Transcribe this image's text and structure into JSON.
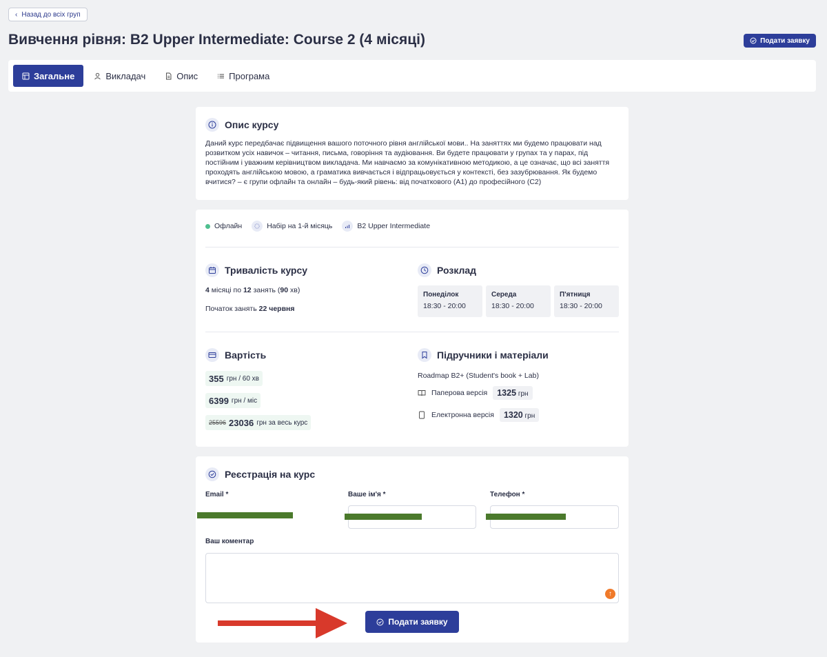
{
  "nav": {
    "back_label": "Назад до всіх груп"
  },
  "header": {
    "title": "Вивчення рівня: B2 Upper Intermediate: Course 2 (4 місяці)",
    "submit_label": "Подати заявку"
  },
  "tabs": [
    {
      "label": "Загальне",
      "active": true,
      "icon": "table-icon"
    },
    {
      "label": "Викладач",
      "active": false,
      "icon": "user-icon"
    },
    {
      "label": "Опис",
      "active": false,
      "icon": "document-icon"
    },
    {
      "label": "Програма",
      "active": false,
      "icon": "list-icon"
    }
  ],
  "description": {
    "title": "Опис курсу",
    "text": "Даний курс передбачає підвищення вашого поточного рівня англійської мови.. На заняттях ми будемо працювати над розвитком усіх навичок – читання, письма, говоріння та аудіювання. Ви будете працювати у групах та у парах, під постійним і уважним керівництвом викладача. Ми навчаємо за комунікативною методикою, а це означає, що всі заняття проходять англійською мовою, а граматика вивчається і відпрацьовується у контексті, без зазубрювання. Як будемо вчитися? – є групи офлайн та онлайн – будь-який рівень: від початкового (A1) до професійного (C2)"
  },
  "info": {
    "format": "Офлайн",
    "enrollment": "Набір на 1-й місяць",
    "level": "B2 Upper Intermediate",
    "duration": {
      "title": "Тривалість курсу",
      "months": "4",
      "months_text": " місяці по ",
      "lessons": "12",
      "lessons_text": " занять (",
      "minutes": "90",
      "minutes_text": " хв)",
      "start_label": "Початок занять ",
      "start_date": "22 червня"
    },
    "schedule": {
      "title": "Розклад",
      "days": [
        {
          "day": "Понеділок",
          "time": "18:30 - 20:00"
        },
        {
          "day": "Середа",
          "time": "18:30 - 20:00"
        },
        {
          "day": "П'ятниця",
          "time": "18:30 - 20:00"
        }
      ]
    },
    "cost": {
      "title": "Вартість",
      "per_lesson_value": "355",
      "per_lesson_unit": "грн / 60 хв",
      "per_month_value": "6399",
      "per_month_unit": "грн / міс",
      "course_old": "25596",
      "course_value": "23036",
      "course_unit": "грн за весь курс"
    },
    "materials": {
      "title": "Підручники і матеріали",
      "book": "Roadmap B2+ (Student's book + Lab)",
      "paper_label": "Паперова версія",
      "paper_price": "1325",
      "digital_label": "Електронна версія",
      "digital_price": "1320",
      "currency": "грн"
    }
  },
  "registration": {
    "title": "Реєстрація на курс",
    "email_label": "Email *",
    "name_label": "Ваше ім'я *",
    "phone_label": "Телефон *",
    "comment_label": "Ваш коментар",
    "submit_label": "Подати заявку"
  },
  "colors": {
    "primary": "#2d3e9a",
    "accent_green": "#4fbf8f",
    "redaction": "#4b7a2c",
    "arrow": "#d8392b"
  }
}
